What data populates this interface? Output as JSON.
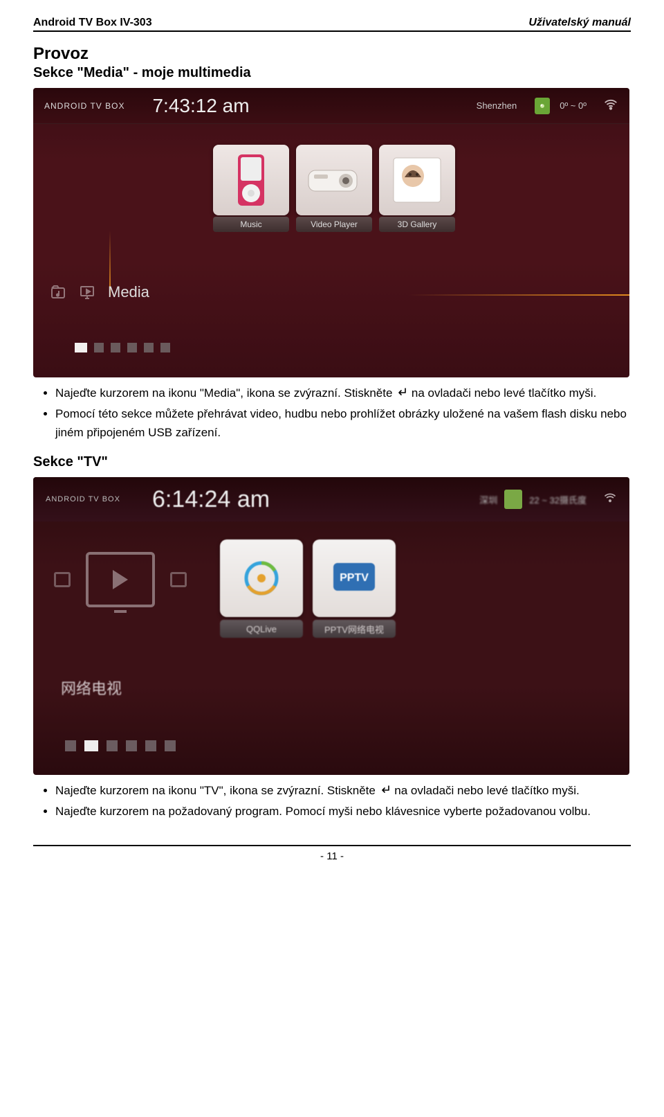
{
  "header": {
    "left": "Android TV Box IV-303",
    "right": "Uživatelský manuál"
  },
  "section1": {
    "h1": "Provoz",
    "h2": "Sekce \"Media\" - moje multimedia",
    "shot": {
      "brand": "ANDROID TV BOX",
      "clock": "7:43:12 am",
      "location": "Shenzhen",
      "temperature": "0º ~ 0º",
      "category_label": "Media",
      "tiles": [
        {
          "icon": "music-player-icon",
          "label": "Music"
        },
        {
          "icon": "projector-icon",
          "label": "Video Player"
        },
        {
          "icon": "photo-icon",
          "label": "3D Gallery"
        }
      ],
      "page_indicator": {
        "total": 6,
        "selected": 0
      }
    },
    "bullets": [
      {
        "pre": "Najeďte kurzorem na ikonu \"Media\", ikona se zvýrazní. Stiskněte ",
        "enter_icon": true,
        "post": " na ovladači nebo levé tlačítko myši."
      },
      {
        "pre": "Pomocí této sekce můžete přehrávat video, hudbu nebo prohlížet obrázky uložené na vašem flash disku nebo jiném připojeném USB zařízení.",
        "enter_icon": false,
        "post": ""
      }
    ]
  },
  "section2": {
    "h2": "Sekce \"TV\"",
    "shot": {
      "brand": "ANDROID TV BOX",
      "clock": "6:14:24 am",
      "location": "深圳",
      "temperature_blur": "22 ~ 32摄氏度",
      "category_label_zh": "网络电视",
      "tiles": [
        {
          "icon": "qqlive-icon",
          "label": "QQLive"
        },
        {
          "icon": "pptv-icon",
          "label": "PPTV网络电视"
        }
      ],
      "page_indicator": {
        "total": 6,
        "selected": 1
      }
    },
    "bullets": [
      {
        "pre": "Najeďte kurzorem na ikonu \"TV\", ikona se zvýrazní. Stiskněte ",
        "enter_icon": true,
        "post": " na ovladači nebo levé tlačítko myši."
      },
      {
        "pre": "Najeďte kurzorem na požadovaný program. Pomocí myši nebo klávesnice vyberte požadovanou volbu.",
        "enter_icon": false,
        "post": ""
      }
    ]
  },
  "footer": {
    "page_number": "- 11 -"
  }
}
